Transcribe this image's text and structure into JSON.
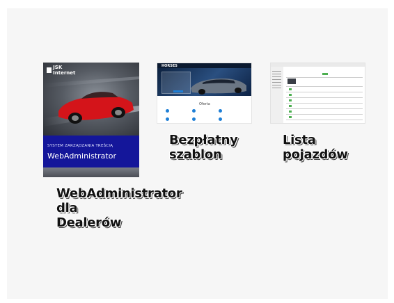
{
  "cards": [
    {
      "title": "WebAdministrator dla Dealerów",
      "thumb": {
        "logo_text": "JSK Internet",
        "subtitle": "SYSTEM ZARZĄDZANIA TREŚCIĄ",
        "brand": "WebAdministrator"
      }
    },
    {
      "title": "Bezpłatny szablon",
      "thumb": {
        "logo_text": "HORSES",
        "section_heading": "Oferta"
      }
    },
    {
      "title": "Lista pojazdów"
    }
  ],
  "colors": {
    "panel_bg": "#f6f6f6",
    "brand_blue": "#14169a",
    "car_red": "#d4141a"
  }
}
